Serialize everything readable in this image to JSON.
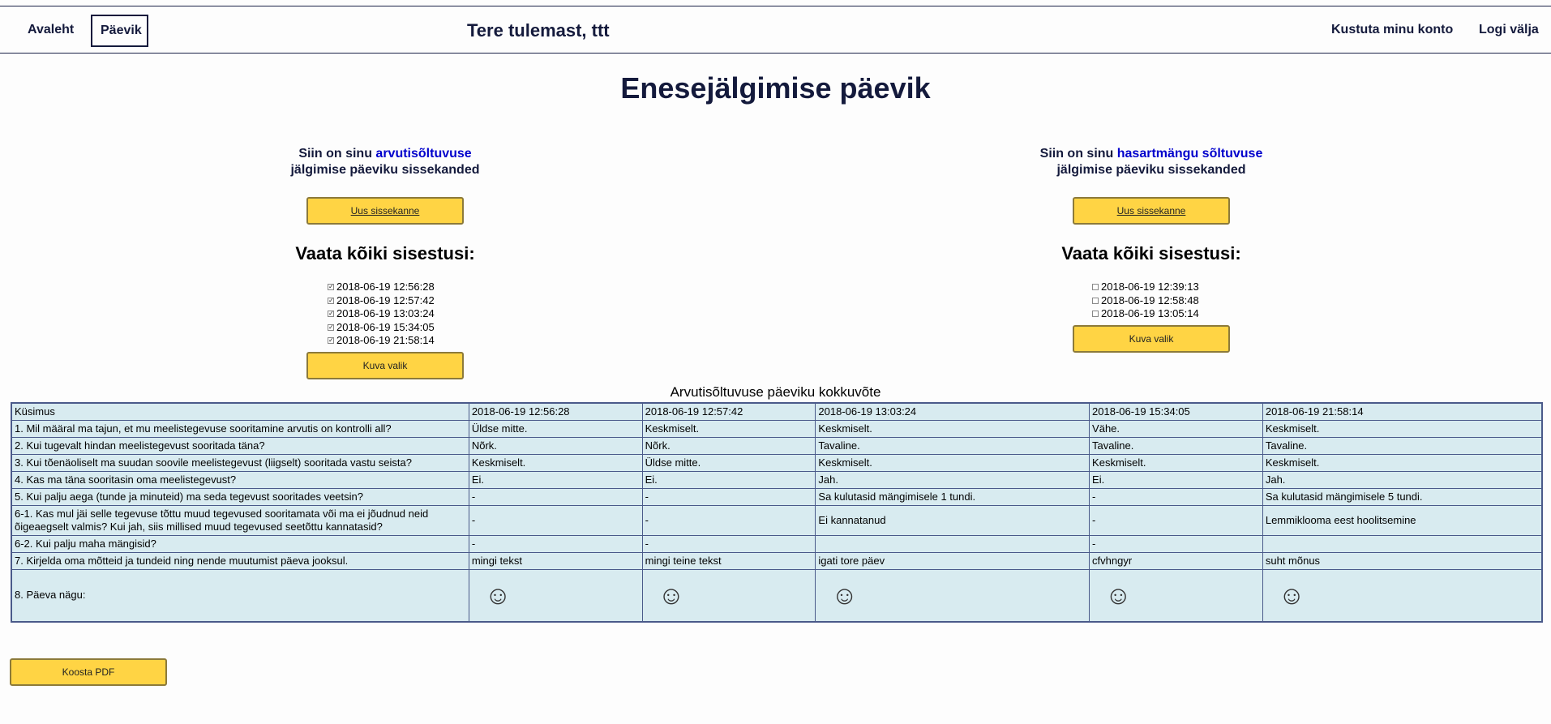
{
  "nav": {
    "home": "Avaleht",
    "diary": "Päevik",
    "welcome": "Tere tulemast, ttt",
    "delete_account": "Kustuta minu konto",
    "logout": "Logi välja"
  },
  "page_title": "Enesejälgimise päevik",
  "left": {
    "intro_pre": "Siin on sinu ",
    "intro_highlight": "arvutisõltuvuse",
    "intro_post": "jälgimise päeviku sissekanded",
    "new_entry": "Uus sissekanne",
    "view_all": "Vaata kõiki sisestusi:",
    "entries": [
      {
        "label": "2018-06-19 12:56:28",
        "checked": true
      },
      {
        "label": "2018-06-19 12:57:42",
        "checked": true
      },
      {
        "label": "2018-06-19 13:03:24",
        "checked": true
      },
      {
        "label": "2018-06-19 15:34:05",
        "checked": true
      },
      {
        "label": "2018-06-19 21:58:14",
        "checked": true
      }
    ],
    "show_selection": "Kuva valik"
  },
  "right": {
    "intro_pre": "Siin on sinu ",
    "intro_highlight": "hasartmängu sõltuvuse",
    "intro_post": "jälgimise päeviku sissekanded",
    "new_entry": "Uus sissekanne",
    "view_all": "Vaata kõiki sisestusi:",
    "entries": [
      {
        "label": "2018-06-19 12:39:13",
        "checked": false
      },
      {
        "label": "2018-06-19 12:58:48",
        "checked": false
      },
      {
        "label": "2018-06-19 13:05:14",
        "checked": false
      }
    ],
    "show_selection": "Kuva valik"
  },
  "summary": {
    "caption": "Arvutisõltuvuse päeviku kokkuvõte",
    "header": [
      "Küsimus",
      "2018-06-19 12:56:28",
      "2018-06-19 12:57:42",
      "2018-06-19 13:03:24",
      "2018-06-19 15:34:05",
      "2018-06-19 21:58:14"
    ],
    "rows": [
      [
        "1. Mil määral ma tajun, et mu meelistegevuse sooritamine arvutis on kontrolli all?",
        "Üldse mitte.",
        "Keskmiselt.",
        "Keskmiselt.",
        "Vähe.",
        "Keskmiselt."
      ],
      [
        "2. Kui tugevalt hindan meelistegevust sooritada täna?",
        "Nõrk.",
        "Nõrk.",
        "Tavaline.",
        "Tavaline.",
        "Tavaline."
      ],
      [
        "3. Kui tõenäoliselt ma suudan soovile meelistegevust (liigselt) sooritada vastu seista?",
        "Keskmiselt.",
        "Üldse mitte.",
        "Keskmiselt.",
        "Keskmiselt.",
        "Keskmiselt."
      ],
      [
        "4. Kas ma täna sooritasin oma meelistegevust?",
        "Ei.",
        "Ei.",
        "Jah.",
        "Ei.",
        "Jah."
      ],
      [
        "5. Kui palju aega (tunde ja minuteid) ma seda tegevust sooritades veetsin?",
        "-",
        "-",
        "Sa kulutasid mängimisele 1 tundi.",
        "-",
        "Sa kulutasid mängimisele 5 tundi."
      ],
      [
        "6-1. Kas mul jäi selle tegevuse tõttu muud tegevused sooritamata või ma ei jõudnud neid õigeaegselt valmis? Kui jah, siis millised muud tegevused seetõttu kannatasid?",
        "-",
        "-",
        "Ei kannatanud",
        "-",
        "Lemmiklooma eest hoolitsemine"
      ],
      [
        "6-2. Kui palju maha mängisid?",
        "-",
        "-",
        "",
        "-",
        ""
      ],
      [
        "7. Kirjelda oma mõtteid ja tundeid ning nende muutumist päeva jooksul.",
        "mingi tekst",
        "mingi teine tekst",
        "igati tore päev",
        "cfvhngyr",
        "suht mõnus"
      ]
    ],
    "face_label": "8. Päeva nägu:",
    "faces": [
      "smiley-face",
      "smiley-face",
      "smiley-face",
      "smiley-face",
      "smiley-face"
    ]
  },
  "pdf_button": "Koosta PDF",
  "colors": {
    "accent": "#ffd444",
    "nav_text": "#141a3c",
    "highlight": "#0000cc",
    "table_bg": "#d8ebf0"
  }
}
